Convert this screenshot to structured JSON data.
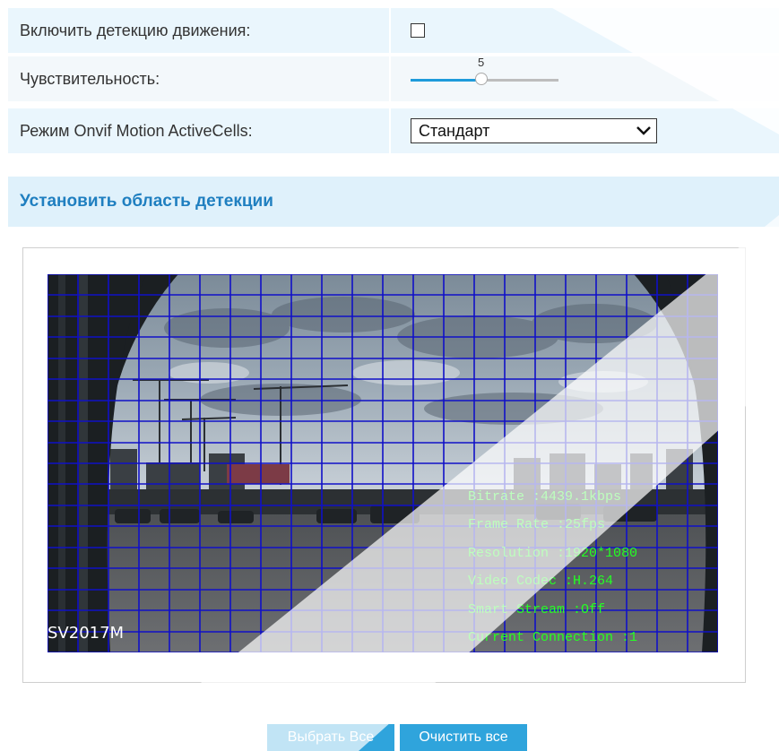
{
  "settings": {
    "enable_detection_label": "Включить детекцию движения:",
    "enable_detection_checked": false,
    "sensitivity_label": "Чувствительность:",
    "sensitivity_value": "5",
    "sensitivity_fraction": 0.48,
    "mode_label": "Режим Onvif Motion ActiveCells:",
    "mode_selected": "Стандарт"
  },
  "section": {
    "title": "Установить область детекции"
  },
  "video": {
    "camera_name": "SV2017M",
    "grid_color": "#1010c8",
    "osd_color": "#24ff24",
    "osd": [
      "Bitrate :4439.1kbps",
      "Frame Rate :25fps",
      "Resolution :1920*1080",
      "Video Codec :H.264",
      "Smart Stream :Off",
      "Current Connection :1"
    ]
  },
  "buttons": {
    "select_all": "Выбрать Все",
    "clear_all": "Очистить все"
  },
  "colors": {
    "accent": "#2fa4dc",
    "section_text": "#1f7fc0"
  }
}
